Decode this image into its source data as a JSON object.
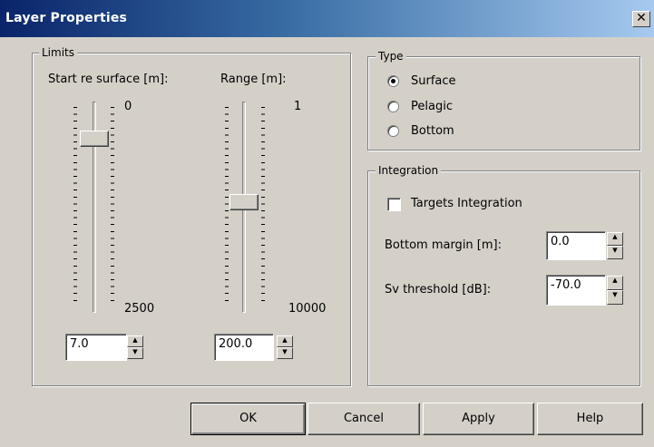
{
  "window": {
    "title": "Layer Properties",
    "close_glyph": "✕",
    "close_icon": "close-icon"
  },
  "limits": {
    "group_label": "Limits",
    "start": {
      "label": "Start re surface [m]:",
      "min_label": "0",
      "max_label": "2500",
      "value": "7.0",
      "slider_fraction": 0.16
    },
    "range": {
      "label": "Range [m]:",
      "min_label": "1",
      "max_label": "10000",
      "value": "200.0",
      "slider_fraction": 0.5
    }
  },
  "type": {
    "group_label": "Type",
    "options": [
      {
        "label": "Surface",
        "selected": true
      },
      {
        "label": "Pelagic",
        "selected": false
      },
      {
        "label": "Bottom",
        "selected": false
      }
    ]
  },
  "integration": {
    "group_label": "Integration",
    "targets_label": "Targets Integration",
    "targets_checked": false,
    "bottom_margin_label": "Bottom margin [m]:",
    "bottom_margin_value": "0.0",
    "sv_threshold_label": "Sv threshold [dB]:",
    "sv_threshold_value": "-70.0"
  },
  "buttons": {
    "ok": "OK",
    "cancel": "Cancel",
    "apply": "Apply",
    "help": "Help"
  },
  "spin_up_glyph": "▲",
  "spin_down_glyph": "▼"
}
